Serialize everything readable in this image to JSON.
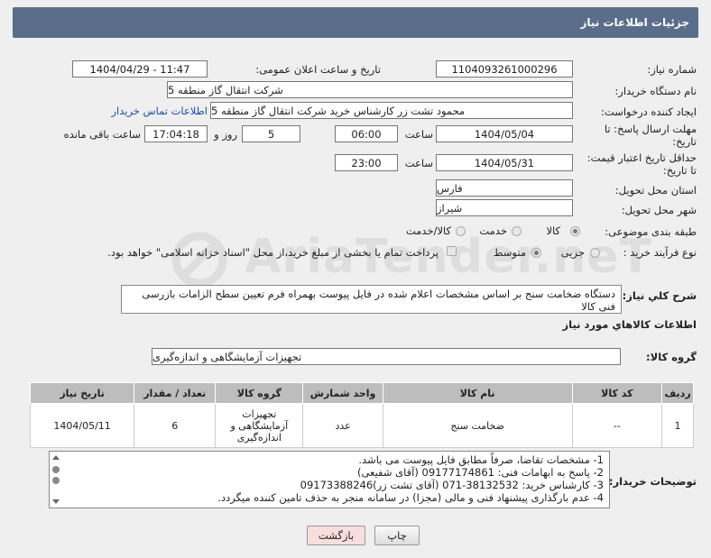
{
  "header": {
    "title": "جزئیات اطلاعات نیاز"
  },
  "fields": {
    "need_number_label": "شماره نیاز:",
    "need_number": "1104093261000296",
    "announce_label": "تاریخ و ساعت اعلان عمومی:",
    "announce_value": "1404/04/29 - 11:47",
    "buyer_org_label": "نام دستگاه خریدار:",
    "buyer_org": "شرکت انتقال گاز منطقه 5",
    "creator_label": "ایجاد کننده درخواست:",
    "creator": "محمود تشت زر کارشناس خرید شرکت انتقال گاز منطقه 5",
    "contact_link": "اطلاعات تماس خریدار",
    "deadline_label_1": "مهلت ارسال پاسخ: تا",
    "deadline_label_2": "تاریخ:",
    "deadline_date": "1404/05/04",
    "hour_label": "ساعت",
    "deadline_time": "06:00",
    "days_value": "5",
    "days_label": "روز و",
    "remaining_time": "17:04:18",
    "remaining_label": "ساعت باقی مانده",
    "validity_label_1": "حداقل تاریخ اعتبار قیمت:",
    "validity_label_2": "تا تاریخ:",
    "validity_date": "1404/05/31",
    "validity_hour_label": "ساعت",
    "validity_time": "23:00",
    "province_label": "استان محل تحویل:",
    "province": "فارس",
    "city_label": "شهر محل تحویل:",
    "city": "شیراز",
    "category_label": "طبقه بندی موضوعی:",
    "category_options": [
      "کالا",
      "خدمت",
      "کالا/خدمت"
    ],
    "process_label": "نوع فرآیند خرید :",
    "process_options": [
      "جزیی",
      "متوسط"
    ],
    "payment_note": "پرداخت تمام یا بخشی از مبلغ خرید،از محل \"اسناد خزانه اسلامی\" خواهد بود.",
    "desc_label": "شرح كلي نياز:",
    "desc_value": "دستگاه ضخامت سنج بر اساس مشخصات اعلام شده در فایل پیوست بهمراه فرم تعیین سطح  الزامات بازرسی فنی کالا",
    "goods_info_title": "اطلاعات كالاهاي مورد نياز",
    "goods_group_label": "گروه کالا:",
    "goods_group": "تجهیزات آزمایشگاهی و اندازه‌گیری"
  },
  "table": {
    "headers": [
      "ردیف",
      "کد کالا",
      "نام کالا",
      "واحد شمارش",
      "گروه کالا",
      "تعداد / مقدار",
      "تاریخ نیاز"
    ],
    "rows": [
      [
        "1",
        "--",
        "ضخامت سنج",
        "عدد",
        "تجهیزات آزمایشگاهی و اندازه‌گیری",
        "6",
        "1404/05/11"
      ]
    ]
  },
  "notes": {
    "label": "توضیحات خریدار:",
    "lines": [
      "1-  مشخصات تقاضا، صرفاً مطابق فایل پیوست می باشد.",
      "2- پاسخ به ابهامات فنی: 09177174861 (آقای شفیعی)",
      "3- کارشناس خرید: 38132532-071 (آقای تشت زر)09173388246",
      "4- عدم بارگذاری پیشنهاد فنی و مالی (مجزا) در سامانه منجر به حذف تامین کننده میگردد."
    ]
  },
  "buttons": {
    "print": "چاپ",
    "back": "بازگشت"
  },
  "watermark": "AriaTender.neT",
  "colors": {
    "titlebar": "#5a6e8c",
    "link": "#1a4fa8",
    "back_button": "#f9dede"
  }
}
